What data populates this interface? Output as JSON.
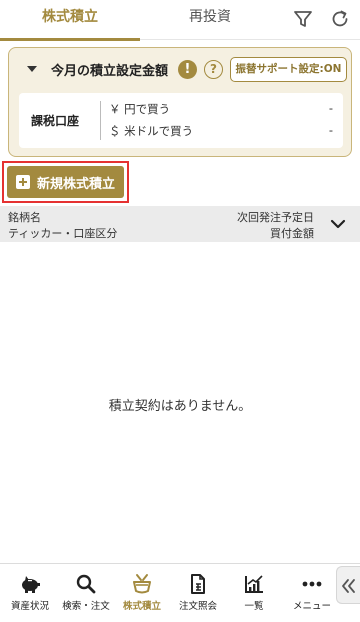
{
  "tabs": [
    {
      "label": "株式積立",
      "active": true
    },
    {
      "label": "再投資",
      "active": false
    }
  ],
  "header_icons": [
    "filter-icon",
    "refresh-icon"
  ],
  "setting_card": {
    "title": "今月の積立設定金額",
    "warning_mark": "!",
    "help_mark": "?",
    "support_button": "振替サポート設定:ON",
    "account_label": "課税口座",
    "rows": [
      {
        "label": "￥ 円で買う",
        "value": "-"
      },
      {
        "label": "＄ 米ドルで買う",
        "value": "-"
      }
    ]
  },
  "new_button": {
    "label": "新規株式積立"
  },
  "list_header": {
    "top_left": "銘柄名",
    "bottom_left": "ティッカー・口座区分",
    "top_right": "次回発注予定日",
    "bottom_right": "買付金額"
  },
  "empty_message": "積立契約はありません。",
  "bottom_nav": [
    {
      "label": "資産状況",
      "icon": "piggy-bank-icon"
    },
    {
      "label": "検索・注文",
      "icon": "search-icon"
    },
    {
      "label": "株式積立",
      "icon": "pot-icon",
      "active": true
    },
    {
      "label": "注文照会",
      "icon": "order-document-icon"
    },
    {
      "label": "一覧",
      "icon": "chart-icon"
    },
    {
      "label": "メニュー",
      "icon": "more-dots-icon"
    }
  ],
  "colors": {
    "accent": "#a38a3f",
    "card_bg": "#f5f0e1",
    "highlight": "#e53131"
  }
}
